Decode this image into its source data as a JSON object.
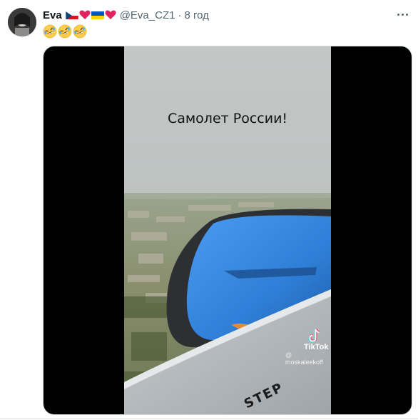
{
  "tweet": {
    "author_name": "Eva",
    "handle": "@Eva_CZ1",
    "separator": "·",
    "time": "8 год",
    "text_emoji": [
      "rofl",
      "rofl",
      "rofl"
    ]
  },
  "media": {
    "caption": "Самолет России!",
    "watermark_brand": "TikTok",
    "watermark_user": "@ moskaleekoff",
    "wing_marking": "STEP"
  },
  "colors": {
    "name": "#0f1419",
    "secondary": "#536471",
    "engine_blue": "#2f7fd8",
    "heart": "#e0245e"
  },
  "icons": [
    "czech-flag-icon",
    "red-heart-icon",
    "ukraine-flag-icon",
    "red-heart-icon",
    "more-options-icon",
    "tiktok-logo-icon"
  ]
}
